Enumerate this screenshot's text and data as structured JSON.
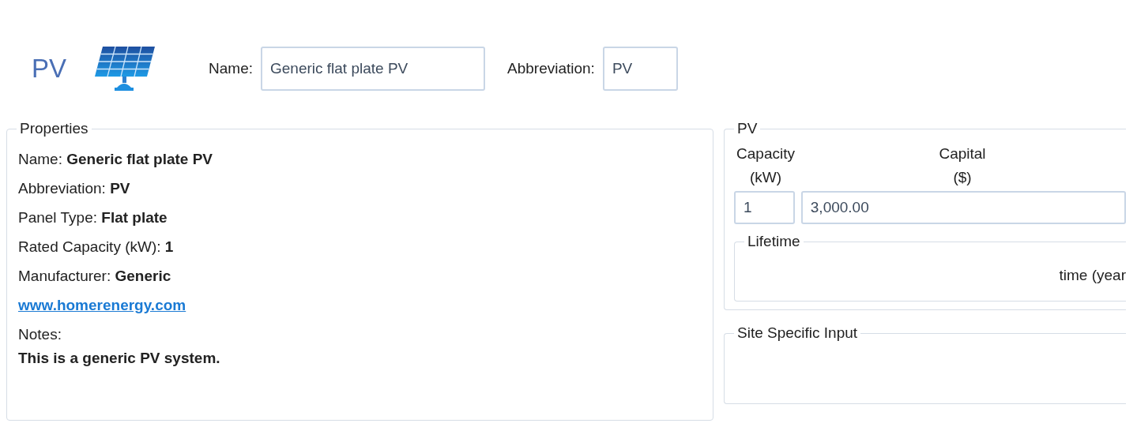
{
  "header": {
    "title": "PV",
    "name_label": "Name:",
    "name_value": "Generic flat plate PV",
    "abbreviation_label": "Abbreviation:",
    "abbreviation_value": "PV"
  },
  "properties": {
    "title": "Properties",
    "rows": [
      {
        "kind": "text",
        "text": "Name: **Generic flat plate PV**"
      },
      {
        "kind": "text",
        "text": "Abbreviation: **PV**"
      },
      {
        "kind": "text",
        "text": "Panel Type: **Flat plate**"
      },
      {
        "kind": "text",
        "text": "Rated Capacity (kW): **1**"
      },
      {
        "kind": "text",
        "text": "Manufacturer: **Generic**"
      },
      {
        "kind": "link",
        "text": "www.homerenergy.com"
      },
      {
        "kind": "text",
        "text": "Notes:"
      },
      {
        "kind": "note",
        "text": "This is a generic PV system."
      }
    ]
  },
  "pv": {
    "title": "PV",
    "capacity_label": [
      "Capacity",
      "(kW)"
    ],
    "capital_label": [
      "Capital",
      "($)"
    ],
    "capacity_value": "1",
    "capital_value": "3,000.00",
    "lifetime": {
      "title": "Lifetime",
      "axis_label": "time (year"
    }
  },
  "site": {
    "title": "Site Specific Input"
  }
}
